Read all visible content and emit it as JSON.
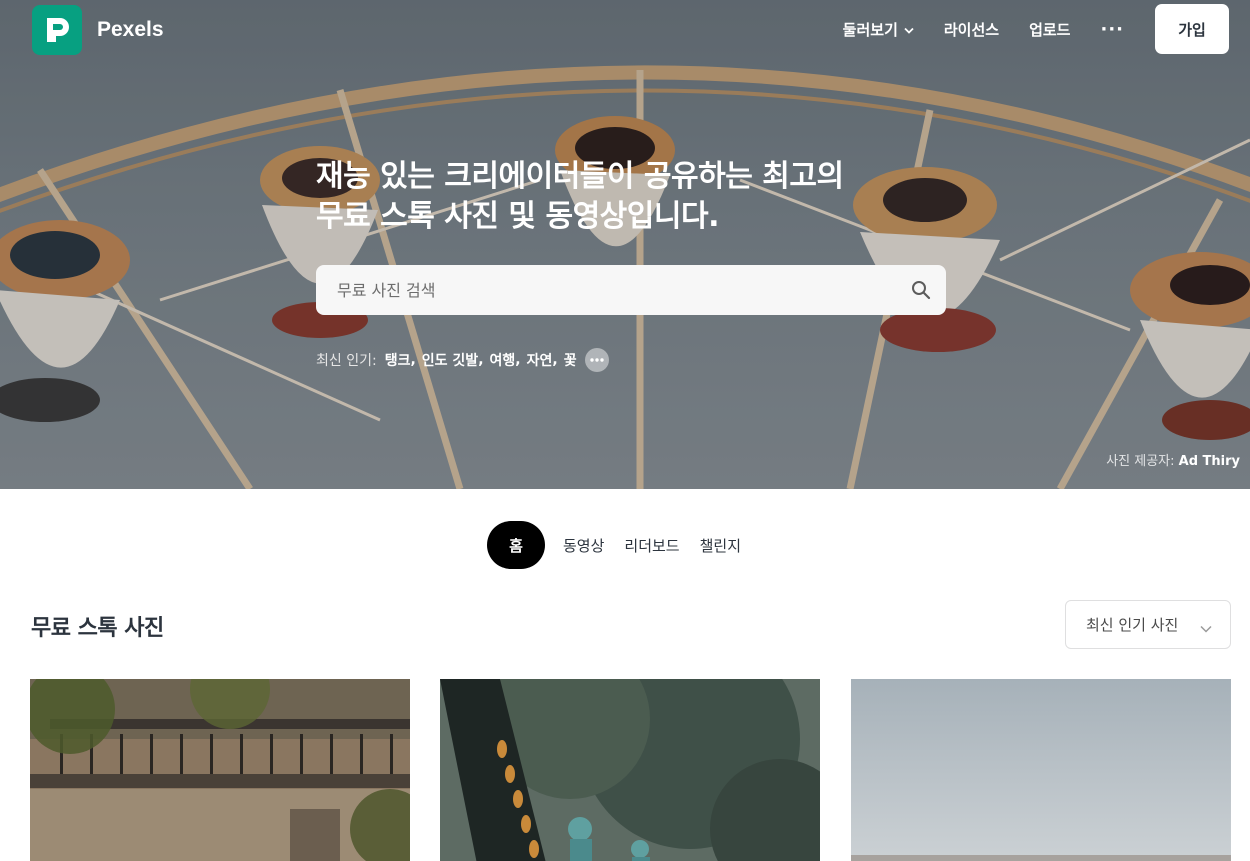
{
  "brand": {
    "name": "Pexels",
    "color": "#07a081"
  },
  "nav": {
    "browse_label": "둘러보기",
    "license_label": "라이선스",
    "upload_label": "업로드",
    "more_label": "···",
    "join_label": "가입"
  },
  "hero": {
    "headline_line1": "재능 있는 크리에이터들이 공유하는 최고의",
    "headline_line2": "무료 스톡 사진 및 동영상입니다.",
    "search_placeholder": "무료 사진 검색",
    "trending_label": "최신 인기:",
    "trending_tags": [
      "탱크",
      "인도 깃발",
      "여행",
      "자연",
      "꽃"
    ],
    "credit_prefix": "사진 제공자:",
    "credit_name": "Ad Thiry"
  },
  "tabs": [
    {
      "label": "홈",
      "active": true
    },
    {
      "label": "동영상",
      "active": false
    },
    {
      "label": "리더보드",
      "active": false
    },
    {
      "label": "챌린지",
      "active": false
    }
  ],
  "section": {
    "title": "무료 스톡 사진",
    "sort_label": "최신 인기 사진"
  },
  "icons": {
    "search": "search-icon",
    "chevron": "chevron-down-icon",
    "more": "more-horizontal-icon"
  },
  "colors": {
    "text": "#2c343e",
    "active_tab": "#000000",
    "search_bg": "#f7f7f7"
  }
}
